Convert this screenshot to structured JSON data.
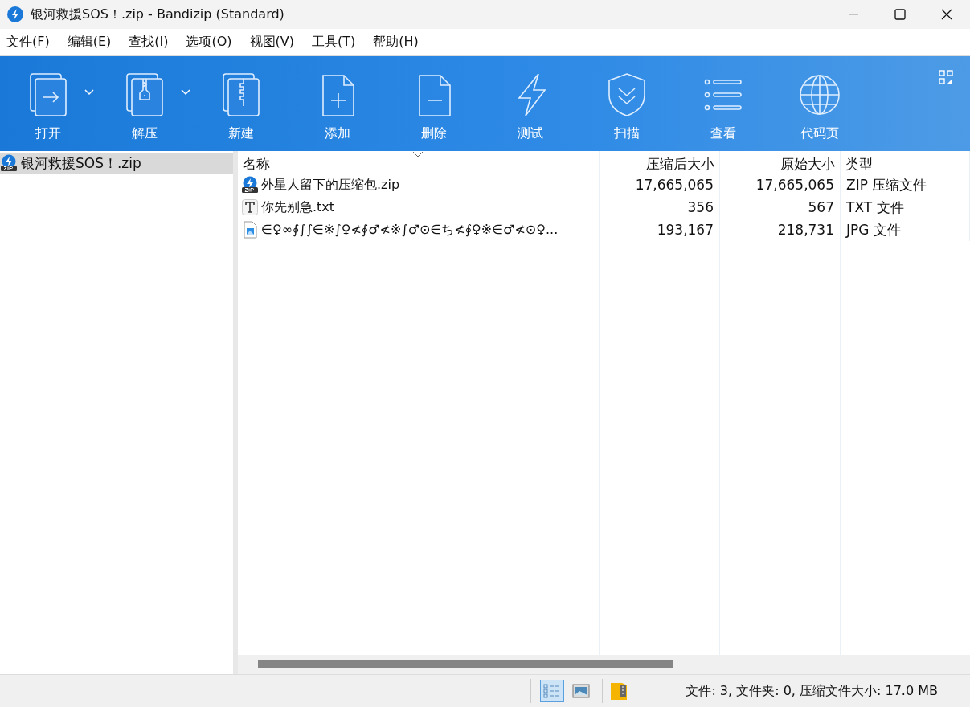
{
  "window": {
    "title": "银河救援SOS！.zip - Bandizip (Standard)"
  },
  "menu": [
    "文件(F)",
    "编辑(E)",
    "查找(I)",
    "选项(O)",
    "视图(V)",
    "工具(T)",
    "帮助(H)"
  ],
  "toolbar": [
    {
      "label": "打开",
      "kind": "open",
      "dropdown": true
    },
    {
      "label": "解压",
      "kind": "extract",
      "dropdown": true
    },
    {
      "label": "新建",
      "kind": "new",
      "dropdown": false
    },
    {
      "label": "添加",
      "kind": "add",
      "dropdown": false
    },
    {
      "label": "删除",
      "kind": "delete",
      "dropdown": false
    },
    {
      "label": "测试",
      "kind": "test",
      "dropdown": false
    },
    {
      "label": "扫描",
      "kind": "scan",
      "dropdown": false
    },
    {
      "label": "查看",
      "kind": "view",
      "dropdown": false
    },
    {
      "label": "代码页",
      "kind": "codepage",
      "dropdown": false
    }
  ],
  "sidebar": {
    "items": [
      {
        "label": "银河救援SOS！.zip",
        "selected": true
      }
    ]
  },
  "table": {
    "columns": [
      "名称",
      "压缩后大小",
      "原始大小",
      "类型"
    ],
    "rows": [
      {
        "kind": "zip",
        "name": "外星人留下的压缩包.zip",
        "packed": "17,665,065",
        "size": "17,665,065",
        "type": "ZIP 压缩文件"
      },
      {
        "kind": "txt",
        "name": "你先别急.txt",
        "packed": "356",
        "size": "567",
        "type": "TXT 文件"
      },
      {
        "kind": "image",
        "name": "∈♀∞∮∫∫∈※∫♀≮∮♂≮※∫♂⊙∈ち≮∮♀※∈♂≮⊙♀...",
        "packed": "193,167",
        "size": "218,731",
        "type": "JPG 文件"
      }
    ]
  },
  "status_bar": {
    "views": [
      {
        "kind": "list",
        "selected": true
      },
      {
        "kind": "preview",
        "selected": false
      }
    ],
    "text": "文件: 3, 文件夹: 0, 压缩文件大小: 17.0 MB"
  }
}
